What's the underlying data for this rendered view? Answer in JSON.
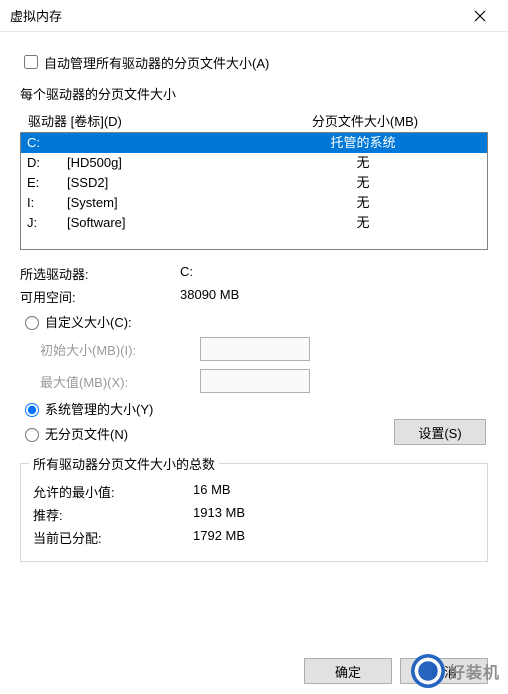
{
  "window": {
    "title": "虚拟内存"
  },
  "auto_manage": {
    "label": "自动管理所有驱动器的分页文件大小(A)",
    "checked": false
  },
  "per_drive_label": "每个驱动器的分页文件大小",
  "headers": {
    "drive": "驱动器 [卷标](D)",
    "size": "分页文件大小(MB)"
  },
  "drives": [
    {
      "letter": "C:",
      "label": "",
      "size": "托管的系统",
      "selected": true
    },
    {
      "letter": "D:",
      "label": "[HD500g]",
      "size": "无",
      "selected": false
    },
    {
      "letter": "E:",
      "label": "[SSD2]",
      "size": "无",
      "selected": false
    },
    {
      "letter": "I:",
      "label": "[System]",
      "size": "无",
      "selected": false
    },
    {
      "letter": "J:",
      "label": "[Software]",
      "size": "无",
      "selected": false
    }
  ],
  "selected_info": {
    "drive_label": "所选驱动器:",
    "drive_value": "C:",
    "space_label": "可用空间:",
    "space_value": "38090 MB"
  },
  "radios": {
    "custom": "自定义大小(C):",
    "system": "系统管理的大小(Y)",
    "none": "无分页文件(N)",
    "selected": "system"
  },
  "custom_fields": {
    "initial_label": "初始大小(MB)(I):",
    "max_label": "最大值(MB)(X):",
    "initial_value": "",
    "max_value": ""
  },
  "set_button": "设置(S)",
  "totals": {
    "legend": "所有驱动器分页文件大小的总数",
    "min_label": "允许的最小值:",
    "min_value": "16 MB",
    "rec_label": "推荐:",
    "rec_value": "1913 MB",
    "cur_label": "当前已分配:",
    "cur_value": "1792 MB"
  },
  "footer": {
    "ok": "确定",
    "cancel": "取消"
  },
  "watermark": "好装机"
}
